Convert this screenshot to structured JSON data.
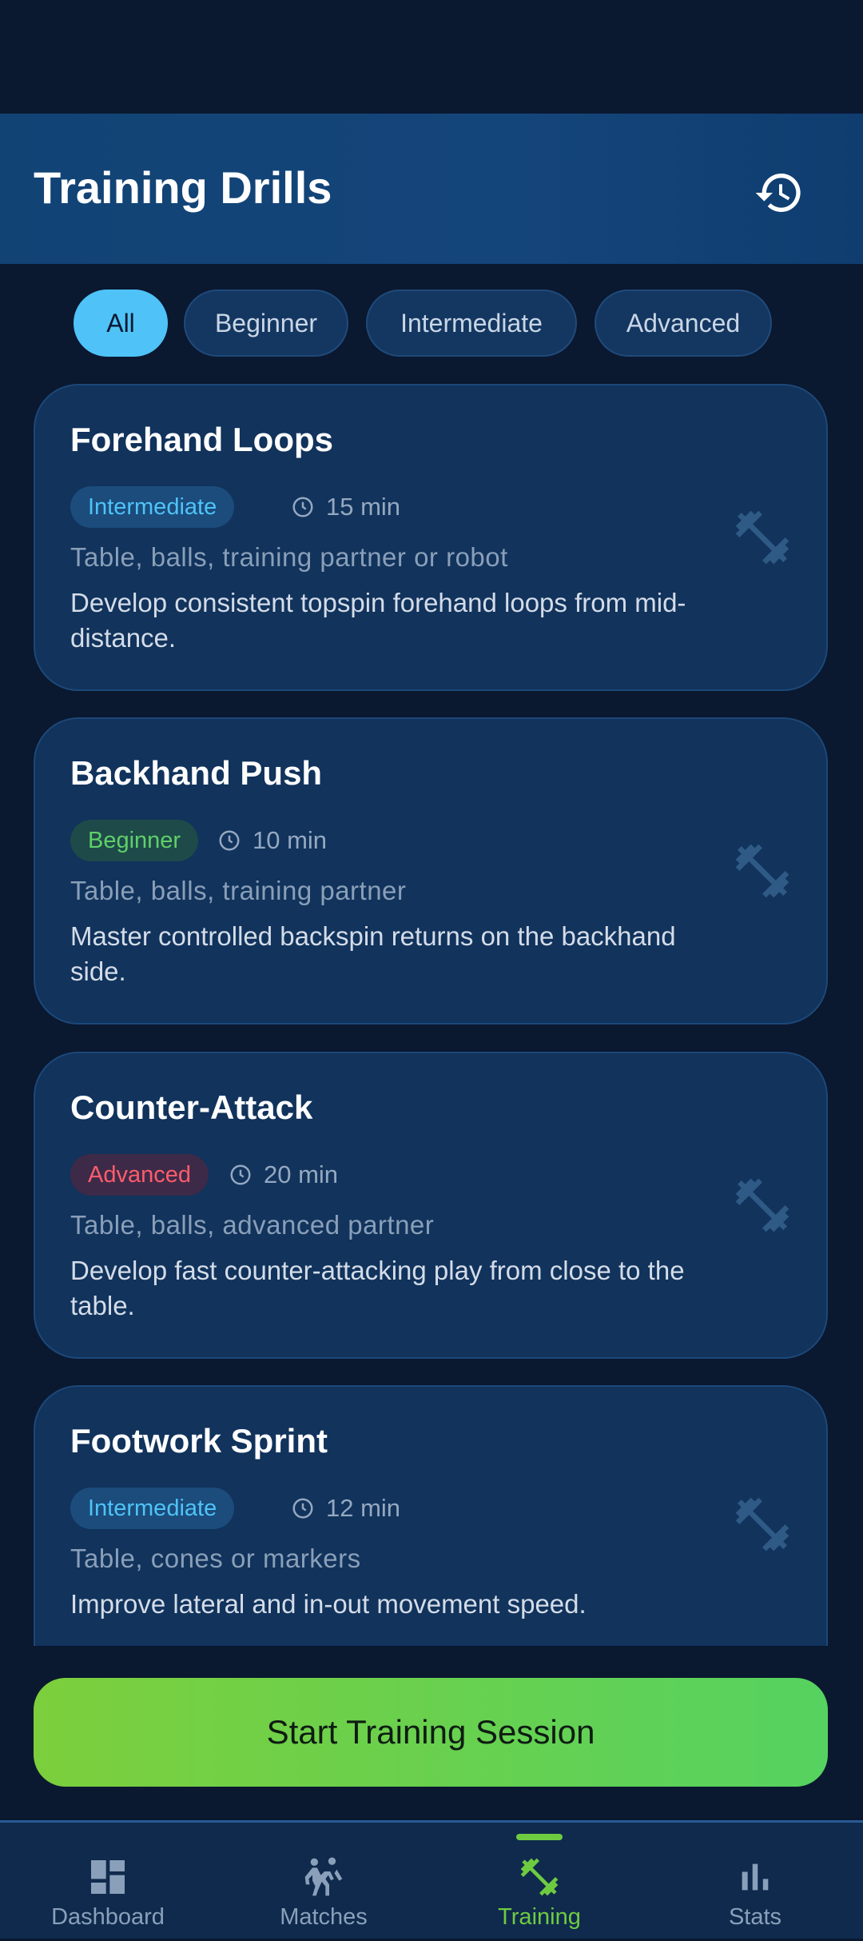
{
  "header": {
    "title": "Training Drills",
    "history_icon": "history-icon"
  },
  "filters": [
    {
      "label": "All",
      "active": true
    },
    {
      "label": "Beginner",
      "active": false
    },
    {
      "label": "Intermediate",
      "active": false
    },
    {
      "label": "Advanced",
      "active": false
    }
  ],
  "drills": [
    {
      "name": "Forehand Loops",
      "level": "Intermediate",
      "duration": "15 min",
      "equipment": "Table, balls, training partner or robot",
      "description": "Develop consistent topspin forehand loops from mid-distance."
    },
    {
      "name": "Backhand Push",
      "level": "Beginner",
      "duration": "10 min",
      "equipment": "Table, balls, training partner",
      "description": "Master controlled backspin returns on the backhand side."
    },
    {
      "name": "Counter-Attack",
      "level": "Advanced",
      "duration": "20 min",
      "equipment": "Table, balls, advanced partner",
      "description": "Develop fast counter-attacking play from close to the table."
    },
    {
      "name": "Footwork Sprint",
      "level": "Intermediate",
      "duration": "12 min",
      "equipment": "Table, cones or markers",
      "description": "Improve lateral and in-out movement speed."
    }
  ],
  "cta": {
    "label": "Start Training Session"
  },
  "nav": [
    {
      "label": "Dashboard",
      "icon": "dashboard-icon",
      "active": false
    },
    {
      "label": "Matches",
      "icon": "matches-icon",
      "active": false
    },
    {
      "label": "Training",
      "icon": "training-icon",
      "active": true
    },
    {
      "label": "Stats",
      "icon": "stats-icon",
      "active": false
    }
  ],
  "colors": {
    "background": "#0a1830",
    "card": "#11335c",
    "accent_blue": "#4fc3f7",
    "accent_green": "#6ecb40",
    "beginner": "#5fd068",
    "advanced": "#ff5c6c"
  }
}
